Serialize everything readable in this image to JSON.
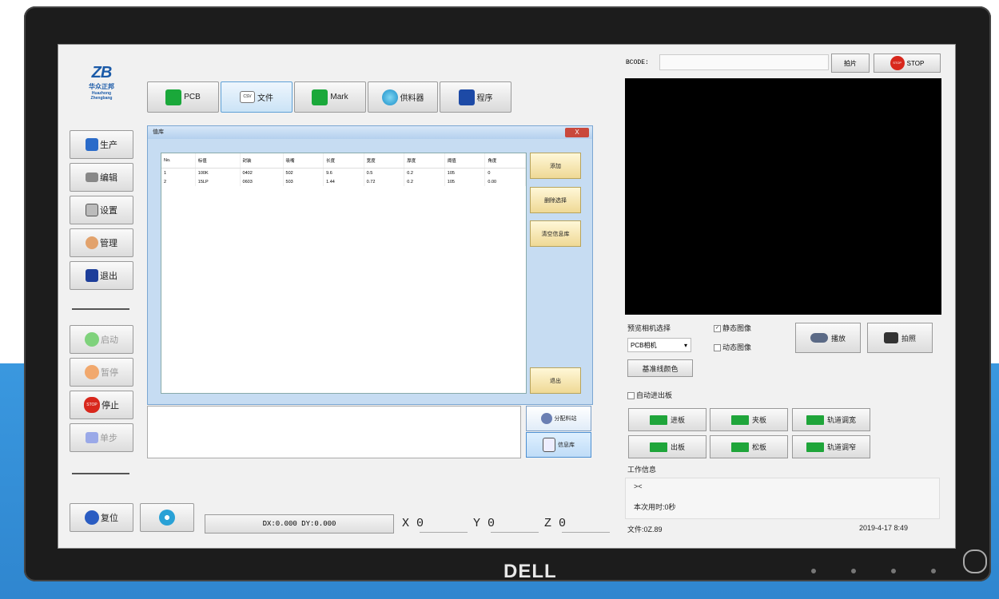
{
  "logo": {
    "mark": "ZB",
    "cn": "华众正邦",
    "en": "Huazhong Zhengbang"
  },
  "toolbar": [
    {
      "label": "PCB",
      "icon": "pcb-icon"
    },
    {
      "label": "文件",
      "icon": "file-icon",
      "icon_text": "CSV"
    },
    {
      "label": "Mark",
      "icon": "mark-icon"
    },
    {
      "label": "供料器",
      "icon": "feeder-icon"
    },
    {
      "label": "程序",
      "icon": "save-icon"
    }
  ],
  "sidebar": {
    "top": [
      {
        "label": "生产",
        "icon": "production-icon"
      },
      {
        "label": "编辑",
        "icon": "edit-icon"
      },
      {
        "label": "设置",
        "icon": "settings-icon"
      },
      {
        "label": "管理",
        "icon": "user-icon"
      },
      {
        "label": "退出",
        "icon": "exit-icon"
      }
    ],
    "bottom": [
      {
        "label": "启动",
        "icon": "start-icon"
      },
      {
        "label": "暂停",
        "icon": "pause-icon"
      },
      {
        "label": "停止",
        "icon": "stop-icon",
        "icon_text": "STOP"
      },
      {
        "label": "单步",
        "icon": "step-icon"
      }
    ],
    "reset_label": "复位"
  },
  "dialog": {
    "title": "值库",
    "close": "X",
    "columns": [
      "No.",
      "标值",
      "封装",
      "吸嘴",
      "长度",
      "宽度",
      "厚度",
      "阈值",
      "角度"
    ],
    "rows": [
      [
        "1",
        "100K",
        "0402",
        "502",
        "9.6",
        "0.5",
        "0.2",
        "105",
        "0"
      ],
      [
        "2",
        "15LP",
        "0603",
        "503",
        "1.44",
        "0.72",
        "0.2",
        "105",
        "0.00"
      ]
    ],
    "buttons": [
      "添加",
      "删除选择",
      "清空信息库"
    ],
    "exit_label": "退出"
  },
  "side_actions": [
    "分配料站",
    "信息库"
  ],
  "status_bar": {
    "text": "DX:0.000 DY:0.000"
  },
  "coords": {
    "x": "X 0",
    "y": "Y 0",
    "z": "Z 0"
  },
  "barcode": {
    "label": "BCODE:",
    "value": "",
    "snap_label": "拍片",
    "stop_label": "STOP",
    "stop_icon_text": "STOP"
  },
  "camera": {
    "select_label": "预览相机选择",
    "select_value": "PCB相机",
    "static_label": "静态图像",
    "static_checked": true,
    "dynamic_label": "动态图像",
    "dynamic_checked": false,
    "play_label": "播放",
    "capture_label": "拍照",
    "crosshair_label": "基准线颜色"
  },
  "auto_board": {
    "label": "自动进出板",
    "checked": false
  },
  "rail": [
    {
      "label": "进板",
      "icon": "board-in-icon"
    },
    {
      "label": "夹板",
      "icon": "clamp-icon"
    },
    {
      "label": "轨道调宽",
      "icon": "widen-icon"
    },
    {
      "label": "出板",
      "icon": "board-out-icon"
    },
    {
      "label": "松板",
      "icon": "release-icon"
    },
    {
      "label": "轨道调窄",
      "icon": "narrow-icon"
    }
  ],
  "work_info": {
    "title": "工作信息",
    "line1": "><",
    "line2": "本次用时:0秒"
  },
  "footer": {
    "file": "文件:0Z.89",
    "datetime": "2019-4-17 8:49"
  },
  "brand": "DELL",
  "colors": {
    "accent_blue": "#3a98df",
    "green": "#1fa53a",
    "stop_red": "#d8271c"
  }
}
